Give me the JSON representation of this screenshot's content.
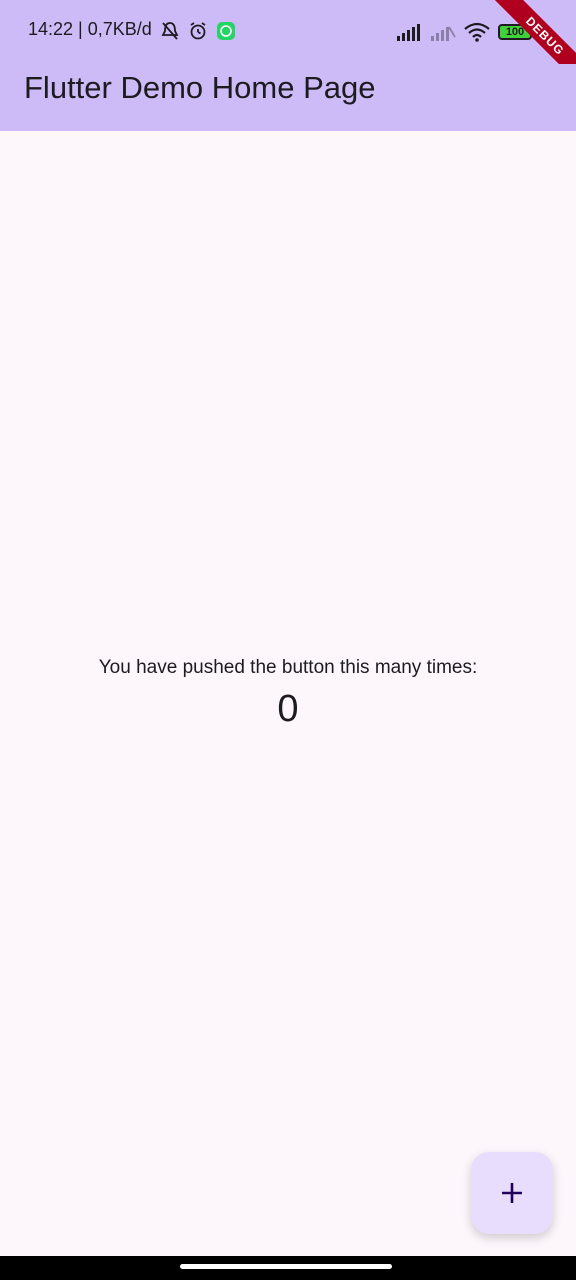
{
  "status_bar": {
    "time_and_speed": "14:22 | 0,7KB/d",
    "battery_label": "100"
  },
  "debug_banner": "DEBUG",
  "app_bar": {
    "title": "Flutter Demo Home Page"
  },
  "counter": {
    "label": "You have pushed the button this many times:",
    "value": "0"
  },
  "fab": {
    "icon": "plus-icon"
  },
  "colors": {
    "app_bar": "#cdbbf8",
    "background": "#fdf7fc",
    "fab": "#e9ddfd",
    "debug": "#b00020"
  }
}
